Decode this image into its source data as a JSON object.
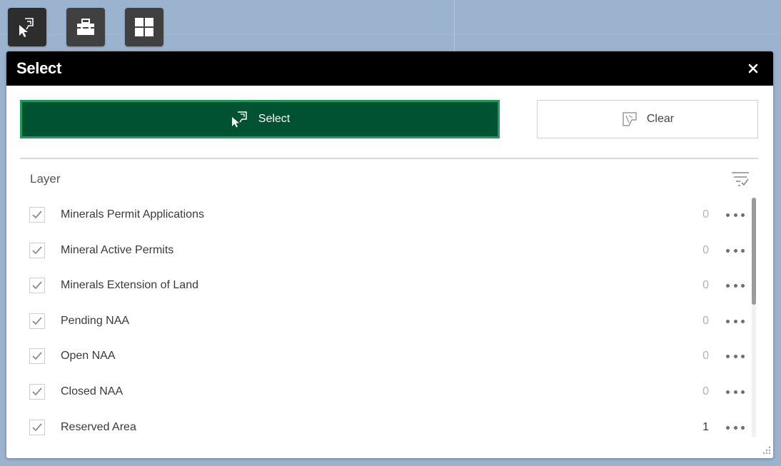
{
  "toolbar": {
    "buttons": [
      {
        "icon": "select-cursor-icon",
        "active": true
      },
      {
        "icon": "toolbox-icon",
        "active": false
      },
      {
        "icon": "grid-icon",
        "active": false
      }
    ]
  },
  "panel": {
    "title": "Select",
    "close_icon": "close-icon",
    "select_label": "Select",
    "clear_label": "Clear",
    "layer_header": "Layer",
    "layers": [
      {
        "name": "Minerals Permit Applications",
        "count": "0",
        "checked": true
      },
      {
        "name": "Mineral Active Permits",
        "count": "0",
        "checked": true
      },
      {
        "name": "Minerals Extension of Land",
        "count": "0",
        "checked": true
      },
      {
        "name": "Pending NAA",
        "count": "0",
        "checked": true
      },
      {
        "name": "Open NAA",
        "count": "0",
        "checked": true
      },
      {
        "name": "Closed NAA",
        "count": "0",
        "checked": true
      },
      {
        "name": "Reserved Area",
        "count": "1",
        "checked": true
      }
    ]
  },
  "colors": {
    "select_button_bg": "#005232",
    "select_button_border": "#1e9a5c",
    "header_bg": "#000000",
    "map_bg": "#9bb3cf"
  }
}
